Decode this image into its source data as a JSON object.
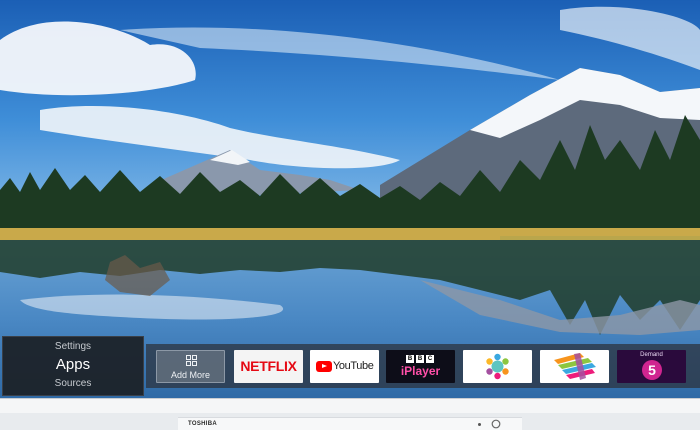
{
  "menu": {
    "settings_label": "Settings",
    "apps_label": "Apps",
    "sources_label": "Sources"
  },
  "apps": {
    "add_more_label": "Add More",
    "netflix_label": "NETFLIX",
    "youtube_label": "YouTube",
    "bbc_letters": [
      "B",
      "B",
      "C"
    ],
    "iplayer_label": "iPlayer",
    "demand5_label": "Demand",
    "demand5_number": "5"
  },
  "tv": {
    "brand": "TOSHIBA"
  },
  "icons": {
    "add_more": "add-more-grid-icon",
    "power": "power-icon",
    "itv": "itv-hub-logo-icon",
    "all4": "all4-logo-icon"
  },
  "colors": {
    "netflix_red": "#e50914",
    "youtube_red": "#ff0000",
    "iplayer_pink": "#ff4fa8",
    "demand5_magenta": "#d02590"
  }
}
